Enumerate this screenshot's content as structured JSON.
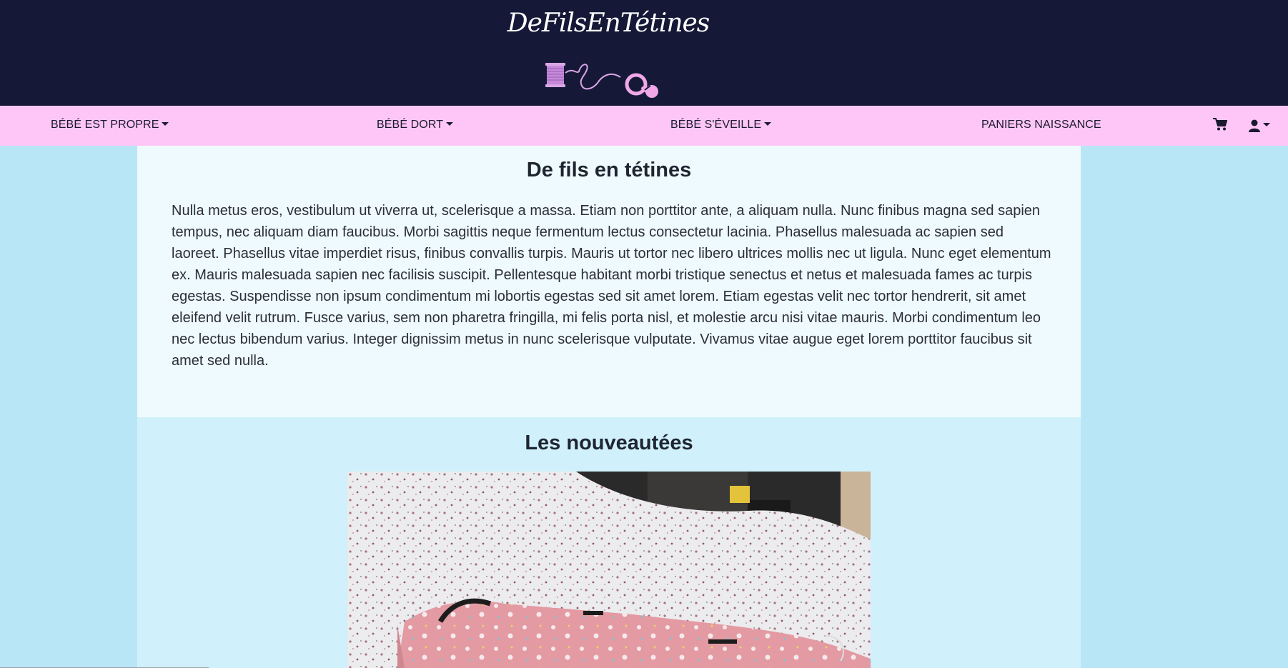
{
  "header": {
    "brand_title": "DeFilsEnTétines",
    "logo_icon": "thread-heart-pacifier-logo"
  },
  "nav": {
    "items": [
      {
        "label": "BÉBÉ EST PROPRE",
        "dropdown": true
      },
      {
        "label": "BÉBÉ DORT",
        "dropdown": true
      },
      {
        "label": "BÉBÉ S'ÉVEILLE",
        "dropdown": true
      },
      {
        "label": "PANIERS NAISSANCE",
        "dropdown": false
      }
    ],
    "cart_icon": "cart-icon",
    "user_icon": "user-icon"
  },
  "intro": {
    "title": "De fils en tétines",
    "text": "Nulla metus eros, vestibulum ut viverra ut, scelerisque a massa. Etiam non porttitor ante, a aliquam nulla. Nunc finibus magna sed sapien tempus, nec aliquam diam faucibus. Morbi sagittis neque fermentum lectus consectetur lacinia. Phasellus malesuada ac sapien sed laoreet. Phasellus vitae imperdiet risus, finibus convallis turpis. Mauris ut tortor nec libero ultrices mollis nec ut ligula. Nunc eget elementum ex. Mauris malesuada sapien nec facilisis suscipit. Pellentesque habitant morbi tristique senectus et netus et malesuada fames ac turpis egestas. Suspendisse non ipsum condimentum mi lobortis egestas sed sit amet lorem. Etiam egestas velit nec tortor hendrerit, sit amet eleifend velit rutrum. Fusce varius, sem non pharetra fringilla, mi felis porta nisl, et molestie arcu nisi vitae mauris. Morbi condimentum leo nec lectus bibendum varius. Integer dignissim metus in nunc scelerisque vulputate. Vivamus vitae augue eget lorem porttitor faucibus sit amet sed nulla."
  },
  "news": {
    "title": "Les nouveautées"
  },
  "colors": {
    "header_bg": "#151937",
    "nav_bg": "#fec6f7",
    "page_bg": "#b8e6f7",
    "intro_bg": "#effafe",
    "news_bg": "#d0f0fb"
  }
}
